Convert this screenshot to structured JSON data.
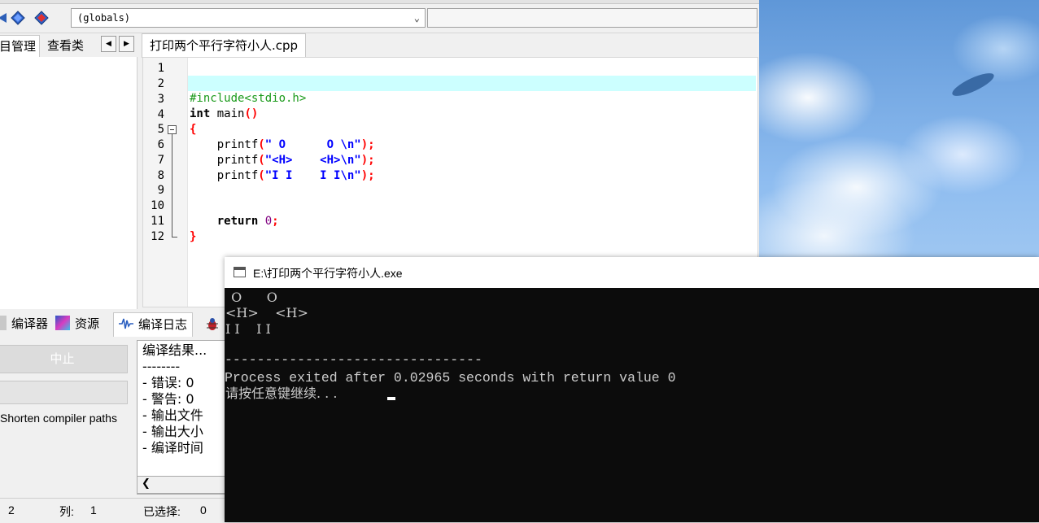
{
  "toolbar": {
    "globals_value": "(globals)"
  },
  "left_tabs": [
    "目管理",
    "查看类"
  ],
  "editor": {
    "tab_label": "打印两个平行字符小人.cpp",
    "line_numbers": [
      "1",
      "2",
      "3",
      "4",
      "5",
      "6",
      "7",
      "8",
      "9",
      "10",
      "11",
      "12"
    ],
    "code": {
      "l3": "#include<stdio.h>",
      "l4_kw": "int",
      "l4_fn": " main",
      "l4_sym": "()",
      "l5": "{",
      "printf": "printf",
      "l6_str": "\" O      O \\n\"",
      "l7_str": "\"<H>    <H>\\n\"",
      "l8_str": "\"I I    I I\\n\"",
      "paren_open": "(",
      "paren_close": ");",
      "return_kw": "return",
      "return_val": "0",
      "semicolon": ";",
      "l12": "}"
    }
  },
  "bottom_tabs": [
    "编译器",
    "资源",
    "编译日志"
  ],
  "bottom_left": {
    "stop_button": "中止",
    "shorten_label": "Shorten compiler paths"
  },
  "compile_log": [
    "编译结果...",
    "--------",
    "- 错误: 0",
    "- 警告: 0",
    "- 输出文件",
    "- 输出大小",
    "- 编译时间"
  ],
  "statusbar": {
    "line_value": "2",
    "col_label": "列:",
    "col_value": "1",
    "sel_label": "已选择:",
    "sel_value": "0"
  },
  "console": {
    "title": "E:\\打印两个平行字符小人.exe",
    "lines": [
      " O      O",
      "<H>    <H>",
      "I I    I I",
      "",
      "--------------------------------",
      "Process exited after 0.02965 seconds with return value 0",
      "请按任意键继续. . ."
    ]
  },
  "colors": {
    "current_line": "#ccffff",
    "preprocessor": "#1a9a1a",
    "string": "#0000ff",
    "symbol": "#ff0000",
    "console_bg": "#0c0c0c",
    "console_text": "#cccccc"
  }
}
